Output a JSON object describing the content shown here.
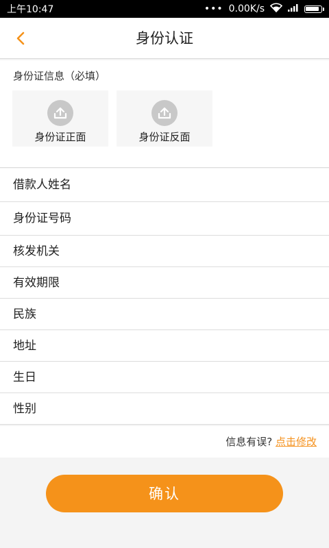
{
  "status_bar": {
    "time": "上午10:47",
    "dots": "•••",
    "network_speed": "0.00K/s",
    "battery_level": 0.9
  },
  "header": {
    "title": "身份认证"
  },
  "id_section": {
    "label": "身份证信息（必填）",
    "front_label": "身份证正面",
    "back_label": "身份证反面"
  },
  "form": {
    "fields": [
      "借款人姓名",
      "身份证号码",
      "核发机关",
      "有效期限",
      "民族",
      "地址",
      "生日",
      "性别"
    ]
  },
  "hint": {
    "text": "信息有误?",
    "link": "点击修改"
  },
  "confirm_label": "确认",
  "colors": {
    "accent": "#f5921a",
    "upload_icon": "#c8c8c8"
  }
}
